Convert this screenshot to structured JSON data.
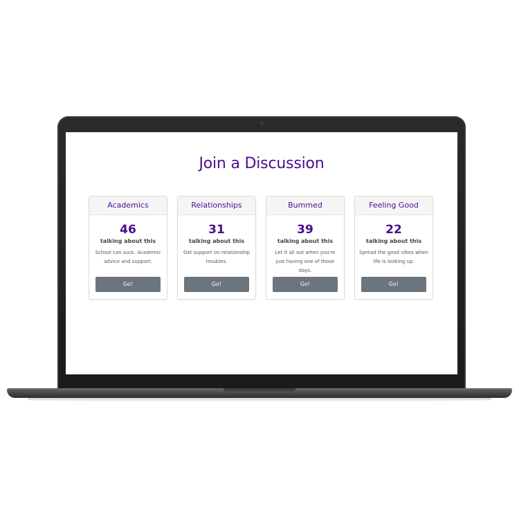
{
  "page": {
    "title": "Join a Discussion"
  },
  "cards": [
    {
      "title": "Academics",
      "count": "46",
      "subtitle": "talking about this",
      "description": "School can suck. Academic advice and support.",
      "button_label": "Go!"
    },
    {
      "title": "Relationships",
      "count": "31",
      "subtitle": "talking about this",
      "description": "Get support on relationship troubles.",
      "button_label": "Go!"
    },
    {
      "title": "Bummed",
      "count": "39",
      "subtitle": "talking about this",
      "description": "Let it all out when you're just having one of those days.",
      "button_label": "Go!"
    },
    {
      "title": "Feeling Good",
      "count": "22",
      "subtitle": "talking about this",
      "description": "Spread the good vibes when life is looking up.",
      "button_label": "Go!"
    }
  ],
  "colors": {
    "accent": "#4b0d8f",
    "button": "#6c757d",
    "card_header_bg": "#f5f5f6",
    "laptop_bezel": "#1b1b1b"
  }
}
